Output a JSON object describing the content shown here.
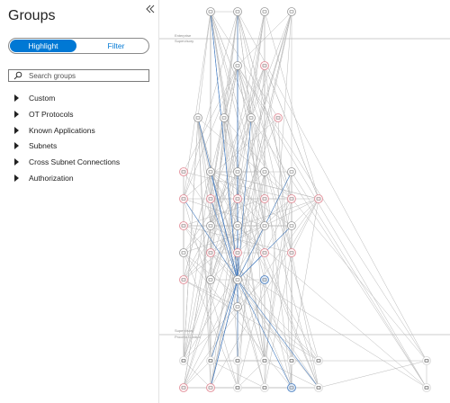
{
  "panel": {
    "title": "Groups",
    "mode_toggle": {
      "highlight": "Highlight",
      "filter": "Filter",
      "selected": "Highlight"
    },
    "search": {
      "placeholder": "Search groups",
      "value": ""
    },
    "groups": [
      {
        "label": "Custom"
      },
      {
        "label": "OT Protocols"
      },
      {
        "label": "Known Applications"
      },
      {
        "label": "Subnets"
      },
      {
        "label": "Cross Subnet Connections"
      },
      {
        "label": "Authorization"
      }
    ]
  },
  "map": {
    "zones": {
      "top_lower": "Enterprise",
      "top_upper": "Supervisory",
      "bottom_lower": "Supervisory",
      "bottom_upper": "Process Control"
    }
  },
  "colors": {
    "accent": "#0078d4",
    "alert_node": "#e8a0a8",
    "edge": "#b8b8b8",
    "highlight_edge": "#4a7fc1"
  }
}
